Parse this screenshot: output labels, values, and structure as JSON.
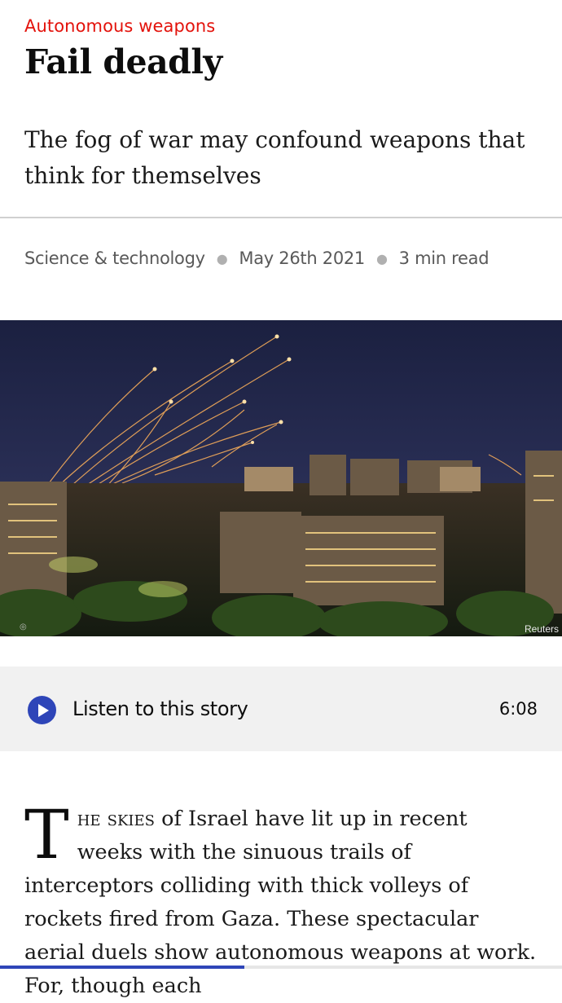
{
  "article": {
    "kicker": "Autonomous weapons",
    "headline": "Fail deadly",
    "subhead": "The fog of war may confound weapons that think for themselves",
    "section": "Science & technology",
    "date": "May 26th 2021",
    "read_time": "3 min read"
  },
  "image": {
    "description_icon": "photo",
    "credit": "Reuters"
  },
  "audio": {
    "play_icon": "play-icon",
    "label": "Listen to this story",
    "duration": "6:08"
  },
  "body": {
    "dropcap": "T",
    "smallcaps": "he skies",
    "text": " of Israel have lit up in recent weeks with the sinuous trails of interceptors colliding with thick volleys of rockets fired from Gaza. These spectacular aerial duels show autonomous weapons at work. For, though each"
  },
  "reading_progress": 0.435,
  "colors": {
    "accent_red": "#e3120b",
    "accent_blue": "#2e45b8"
  }
}
